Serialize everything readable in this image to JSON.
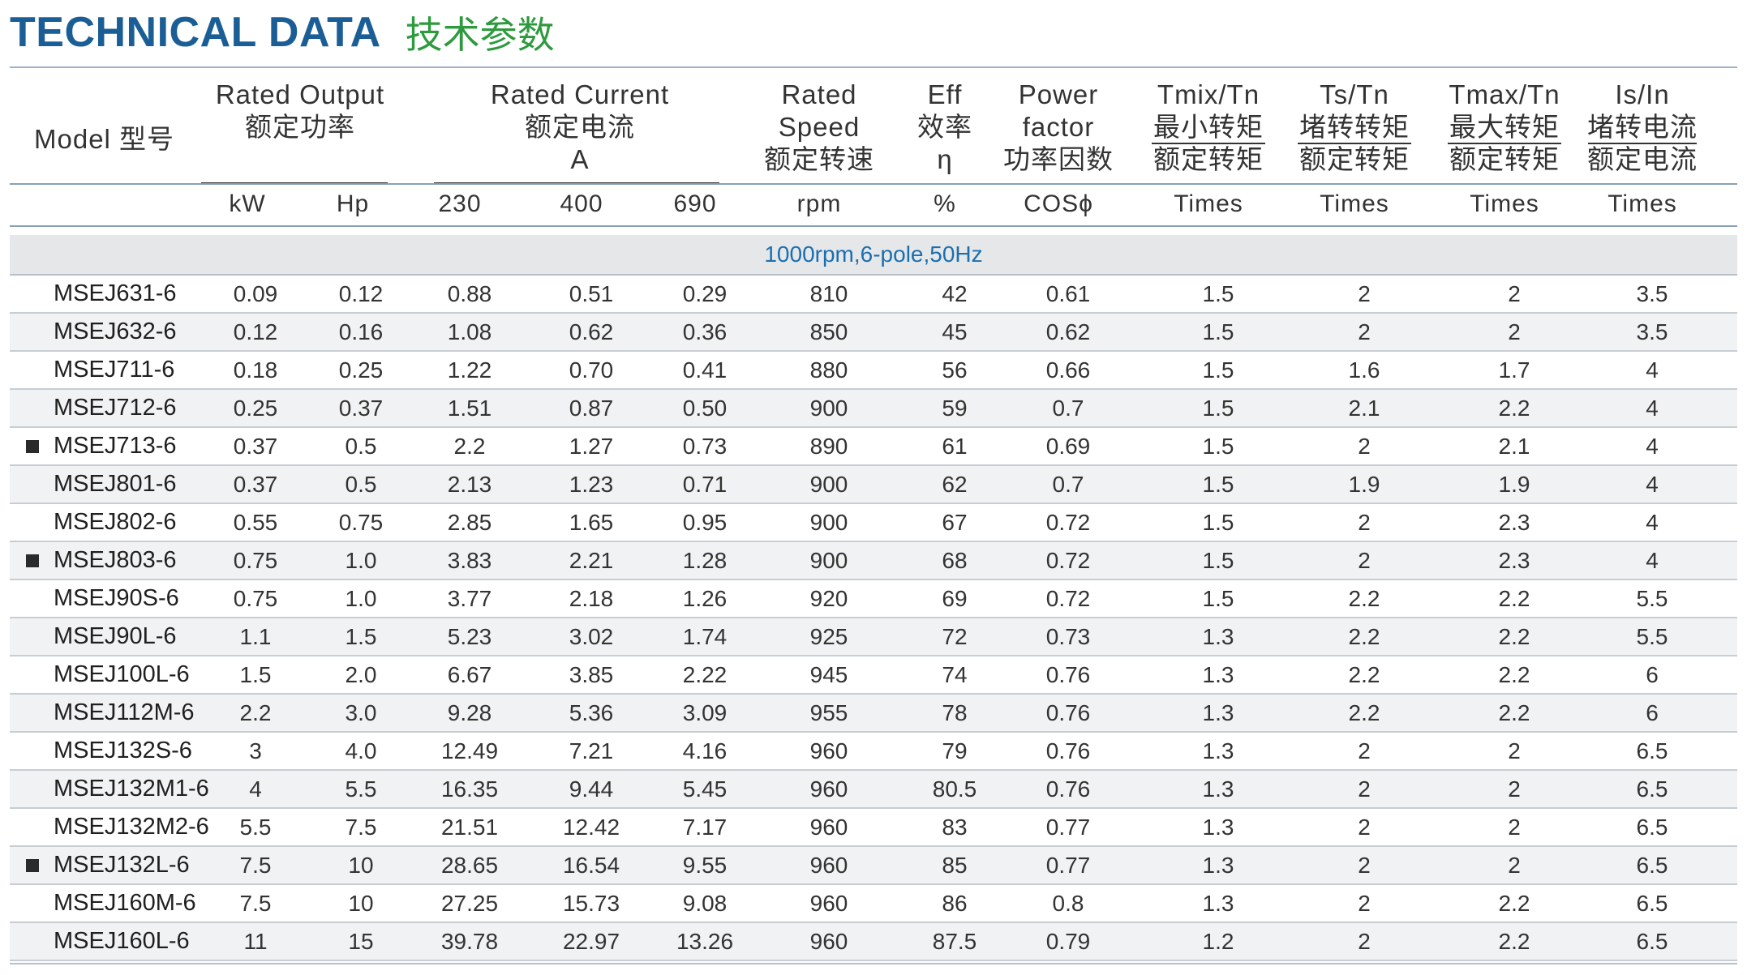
{
  "title": {
    "en": "TECHNICAL DATA",
    "cn": "技术参数"
  },
  "headers": {
    "model": "Model 型号",
    "rated_output": [
      "Rated Output",
      "额定功率"
    ],
    "rated_current": [
      "Rated Current",
      "额定电流",
      "A"
    ],
    "rated_speed": [
      "Rated",
      "Speed",
      "额定转速"
    ],
    "eff": [
      "Eff",
      "效率",
      "η"
    ],
    "power_factor": [
      "Power",
      "factor",
      "功率因数"
    ],
    "tmin": [
      "Tmix/Tn",
      "最小转矩",
      "额定转矩"
    ],
    "ts": [
      "Ts/Tn",
      "堵转转矩",
      "额定转矩"
    ],
    "tmax": [
      "Tmax/Tn",
      "最大转矩",
      "额定转矩"
    ],
    "is": [
      "Is/In",
      "堵转电流",
      "额定电流"
    ]
  },
  "units": [
    "kW",
    "Hp",
    "230",
    "400",
    "690",
    "rpm",
    "%",
    "COSϕ",
    "Times",
    "Times",
    "Times",
    "Times"
  ],
  "section_label": "1000rpm,6-pole,50Hz",
  "rows": [
    {
      "marked": false,
      "model": "MSEJ631-6",
      "kw": "0.09",
      "hp": "0.12",
      "i230": "0.88",
      "i400": "0.51",
      "i690": "0.29",
      "rpm": "810",
      "eff": "42",
      "cos": "0.61",
      "tmin": "1.5",
      "ts": "2",
      "tmax": "2",
      "is": "3.5"
    },
    {
      "marked": false,
      "model": "MSEJ632-6",
      "kw": "0.12",
      "hp": "0.16",
      "i230": "1.08",
      "i400": "0.62",
      "i690": "0.36",
      "rpm": "850",
      "eff": "45",
      "cos": "0.62",
      "tmin": "1.5",
      "ts": "2",
      "tmax": "2",
      "is": "3.5"
    },
    {
      "marked": false,
      "model": "MSEJ711-6",
      "kw": "0.18",
      "hp": "0.25",
      "i230": "1.22",
      "i400": "0.70",
      "i690": "0.41",
      "rpm": "880",
      "eff": "56",
      "cos": "0.66",
      "tmin": "1.5",
      "ts": "1.6",
      "tmax": "1.7",
      "is": "4"
    },
    {
      "marked": false,
      "model": "MSEJ712-6",
      "kw": "0.25",
      "hp": "0.37",
      "i230": "1.51",
      "i400": "0.87",
      "i690": "0.50",
      "rpm": "900",
      "eff": "59",
      "cos": "0.7",
      "tmin": "1.5",
      "ts": "2.1",
      "tmax": "2.2",
      "is": "4"
    },
    {
      "marked": true,
      "model": "MSEJ713-6",
      "kw": "0.37",
      "hp": "0.5",
      "i230": "2.2",
      "i400": "1.27",
      "i690": "0.73",
      "rpm": "890",
      "eff": "61",
      "cos": "0.69",
      "tmin": "1.5",
      "ts": "2",
      "tmax": "2.1",
      "is": "4"
    },
    {
      "marked": false,
      "model": "MSEJ801-6",
      "kw": "0.37",
      "hp": "0.5",
      "i230": "2.13",
      "i400": "1.23",
      "i690": "0.71",
      "rpm": "900",
      "eff": "62",
      "cos": "0.7",
      "tmin": "1.5",
      "ts": "1.9",
      "tmax": "1.9",
      "is": "4"
    },
    {
      "marked": false,
      "model": "MSEJ802-6",
      "kw": "0.55",
      "hp": "0.75",
      "i230": "2.85",
      "i400": "1.65",
      "i690": "0.95",
      "rpm": "900",
      "eff": "67",
      "cos": "0.72",
      "tmin": "1.5",
      "ts": "2",
      "tmax": "2.3",
      "is": "4"
    },
    {
      "marked": true,
      "model": "MSEJ803-6",
      "kw": "0.75",
      "hp": "1.0",
      "i230": "3.83",
      "i400": "2.21",
      "i690": "1.28",
      "rpm": "900",
      "eff": "68",
      "cos": "0.72",
      "tmin": "1.5",
      "ts": "2",
      "tmax": "2.3",
      "is": "4"
    },
    {
      "marked": false,
      "model": "MSEJ90S-6",
      "kw": "0.75",
      "hp": "1.0",
      "i230": "3.77",
      "i400": "2.18",
      "i690": "1.26",
      "rpm": "920",
      "eff": "69",
      "cos": "0.72",
      "tmin": "1.5",
      "ts": "2.2",
      "tmax": "2.2",
      "is": "5.5"
    },
    {
      "marked": false,
      "model": "MSEJ90L-6",
      "kw": "1.1",
      "hp": "1.5",
      "i230": "5.23",
      "i400": "3.02",
      "i690": "1.74",
      "rpm": "925",
      "eff": "72",
      "cos": "0.73",
      "tmin": "1.3",
      "ts": "2.2",
      "tmax": "2.2",
      "is": "5.5"
    },
    {
      "marked": false,
      "model": "MSEJ100L-6",
      "kw": "1.5",
      "hp": "2.0",
      "i230": "6.67",
      "i400": "3.85",
      "i690": "2.22",
      "rpm": "945",
      "eff": "74",
      "cos": "0.76",
      "tmin": "1.3",
      "ts": "2.2",
      "tmax": "2.2",
      "is": "6"
    },
    {
      "marked": false,
      "model": "MSEJ112M-6",
      "kw": "2.2",
      "hp": "3.0",
      "i230": "9.28",
      "i400": "5.36",
      "i690": "3.09",
      "rpm": "955",
      "eff": "78",
      "cos": "0.76",
      "tmin": "1.3",
      "ts": "2.2",
      "tmax": "2.2",
      "is": "6"
    },
    {
      "marked": false,
      "model": "MSEJ132S-6",
      "kw": "3",
      "hp": "4.0",
      "i230": "12.49",
      "i400": "7.21",
      "i690": "4.16",
      "rpm": "960",
      "eff": "79",
      "cos": "0.76",
      "tmin": "1.3",
      "ts": "2",
      "tmax": "2",
      "is": "6.5"
    },
    {
      "marked": false,
      "model": "MSEJ132M1-6",
      "kw": "4",
      "hp": "5.5",
      "i230": "16.35",
      "i400": "9.44",
      "i690": "5.45",
      "rpm": "960",
      "eff": "80.5",
      "cos": "0.76",
      "tmin": "1.3",
      "ts": "2",
      "tmax": "2",
      "is": "6.5"
    },
    {
      "marked": false,
      "model": "MSEJ132M2-6",
      "kw": "5.5",
      "hp": "7.5",
      "i230": "21.51",
      "i400": "12.42",
      "i690": "7.17",
      "rpm": "960",
      "eff": "83",
      "cos": "0.77",
      "tmin": "1.3",
      "ts": "2",
      "tmax": "2",
      "is": "6.5"
    },
    {
      "marked": true,
      "model": "MSEJ132L-6",
      "kw": "7.5",
      "hp": "10",
      "i230": "28.65",
      "i400": "16.54",
      "i690": "9.55",
      "rpm": "960",
      "eff": "85",
      "cos": "0.77",
      "tmin": "1.3",
      "ts": "2",
      "tmax": "2",
      "is": "6.5"
    },
    {
      "marked": false,
      "model": "MSEJ160M-6",
      "kw": "7.5",
      "hp": "10",
      "i230": "27.25",
      "i400": "15.73",
      "i690": "9.08",
      "rpm": "960",
      "eff": "86",
      "cos": "0.8",
      "tmin": "1.3",
      "ts": "2",
      "tmax": "2.2",
      "is": "6.5"
    },
    {
      "marked": false,
      "model": "MSEJ160L-6",
      "kw": "11",
      "hp": "15",
      "i230": "39.78",
      "i400": "22.97",
      "i690": "13.26",
      "rpm": "960",
      "eff": "87.5",
      "cos": "0.79",
      "tmin": "1.2",
      "ts": "2",
      "tmax": "2.2",
      "is": "6.5"
    }
  ]
}
